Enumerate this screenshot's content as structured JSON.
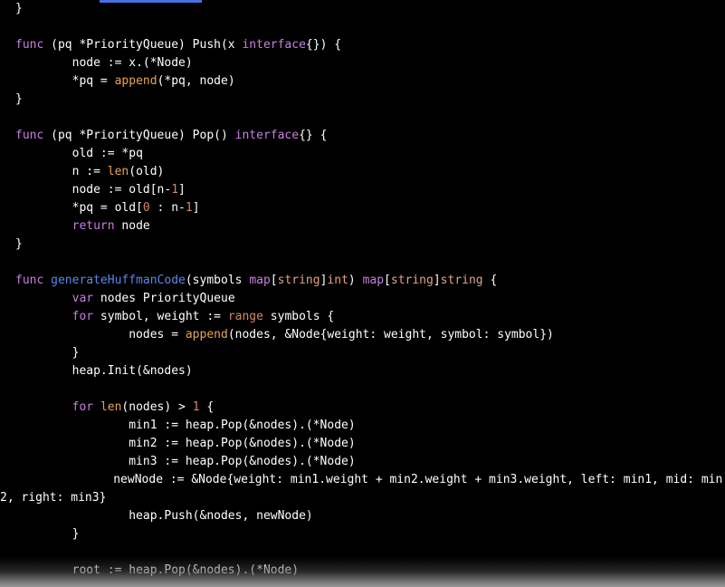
{
  "theme": {
    "background": "#000000",
    "foreground": "#ffffff",
    "keyword": "#c77fe0",
    "function_name": "#5b87e8",
    "builtin": "#e8a451",
    "type": "#e0a384",
    "number": "#d4866b",
    "selection_bar": "#4a6fe0"
  },
  "editor": {
    "language": "Go",
    "font_size_px": 13,
    "line_height_px": 20
  },
  "selection_bar": {
    "label": "text-selection-highlight"
  },
  "code": {
    "lines": [
      {
        "id": "l1",
        "indent": 0,
        "tokens": [
          {
            "t": "}",
            "c": "plain"
          }
        ]
      },
      {
        "id": "l2",
        "indent": 0,
        "tokens": []
      },
      {
        "id": "l3",
        "indent": 0,
        "tokens": [
          {
            "t": "func",
            "c": "kw"
          },
          {
            "t": " (pq *PriorityQueue) Push(x ",
            "c": "plain"
          },
          {
            "t": "interface",
            "c": "kw"
          },
          {
            "t": "{}) {",
            "c": "plain"
          }
        ]
      },
      {
        "id": "l4",
        "indent": 1,
        "tokens": [
          {
            "t": "node := x.(*Node)",
            "c": "plain"
          }
        ]
      },
      {
        "id": "l5",
        "indent": 1,
        "tokens": [
          {
            "t": "*pq = ",
            "c": "plain"
          },
          {
            "t": "append",
            "c": "bi"
          },
          {
            "t": "(*pq, node)",
            "c": "plain"
          }
        ]
      },
      {
        "id": "l6",
        "indent": 0,
        "tokens": [
          {
            "t": "}",
            "c": "plain"
          }
        ]
      },
      {
        "id": "l7",
        "indent": 0,
        "tokens": []
      },
      {
        "id": "l8",
        "indent": 0,
        "tokens": [
          {
            "t": "func",
            "c": "kw"
          },
          {
            "t": " (pq *PriorityQueue) Pop() ",
            "c": "plain"
          },
          {
            "t": "interface",
            "c": "kw"
          },
          {
            "t": "{} {",
            "c": "plain"
          }
        ]
      },
      {
        "id": "l9",
        "indent": 1,
        "tokens": [
          {
            "t": "old := *pq",
            "c": "plain"
          }
        ]
      },
      {
        "id": "l10",
        "indent": 1,
        "tokens": [
          {
            "t": "n := ",
            "c": "plain"
          },
          {
            "t": "len",
            "c": "bi"
          },
          {
            "t": "(old)",
            "c": "plain"
          }
        ]
      },
      {
        "id": "l11",
        "indent": 1,
        "tokens": [
          {
            "t": "node := old[n-",
            "c": "plain"
          },
          {
            "t": "1",
            "c": "num"
          },
          {
            "t": "]",
            "c": "plain"
          }
        ]
      },
      {
        "id": "l12",
        "indent": 1,
        "tokens": [
          {
            "t": "*pq = old[",
            "c": "plain"
          },
          {
            "t": "0",
            "c": "num"
          },
          {
            "t": " : n-",
            "c": "plain"
          },
          {
            "t": "1",
            "c": "num"
          },
          {
            "t": "]",
            "c": "plain"
          }
        ]
      },
      {
        "id": "l13",
        "indent": 1,
        "tokens": [
          {
            "t": "return",
            "c": "kw"
          },
          {
            "t": " node",
            "c": "plain"
          }
        ]
      },
      {
        "id": "l14",
        "indent": 0,
        "tokens": [
          {
            "t": "}",
            "c": "plain"
          }
        ]
      },
      {
        "id": "l15",
        "indent": 0,
        "tokens": []
      },
      {
        "id": "l16",
        "indent": 0,
        "tokens": [
          {
            "t": "func",
            "c": "kw"
          },
          {
            "t": " ",
            "c": "plain"
          },
          {
            "t": "generateHuffmanCode",
            "c": "fn"
          },
          {
            "t": "(symbols ",
            "c": "plain"
          },
          {
            "t": "map",
            "c": "kw"
          },
          {
            "t": "[",
            "c": "plain"
          },
          {
            "t": "string",
            "c": "type"
          },
          {
            "t": "]",
            "c": "plain"
          },
          {
            "t": "int",
            "c": "type"
          },
          {
            "t": ") ",
            "c": "plain"
          },
          {
            "t": "map",
            "c": "kw"
          },
          {
            "t": "[",
            "c": "plain"
          },
          {
            "t": "string",
            "c": "type"
          },
          {
            "t": "]",
            "c": "plain"
          },
          {
            "t": "string",
            "c": "type"
          },
          {
            "t": " {",
            "c": "plain"
          }
        ]
      },
      {
        "id": "l17",
        "indent": 1,
        "tokens": [
          {
            "t": "var",
            "c": "kw"
          },
          {
            "t": " nodes PriorityQueue",
            "c": "plain"
          }
        ]
      },
      {
        "id": "l18",
        "indent": 1,
        "tokens": [
          {
            "t": "for",
            "c": "kw"
          },
          {
            "t": " symbol, weight := ",
            "c": "plain"
          },
          {
            "t": "range",
            "c": "rng"
          },
          {
            "t": " symbols {",
            "c": "plain"
          }
        ]
      },
      {
        "id": "l19",
        "indent": 2,
        "tokens": [
          {
            "t": "nodes = ",
            "c": "plain"
          },
          {
            "t": "append",
            "c": "bi"
          },
          {
            "t": "(nodes, &Node{weight: weight, symbol: symbol})",
            "c": "plain"
          }
        ]
      },
      {
        "id": "l20",
        "indent": 1,
        "tokens": [
          {
            "t": "}",
            "c": "plain"
          }
        ]
      },
      {
        "id": "l21",
        "indent": 1,
        "tokens": [
          {
            "t": "heap.Init(&nodes)",
            "c": "plain"
          }
        ]
      },
      {
        "id": "l22",
        "indent": 0,
        "tokens": []
      },
      {
        "id": "l23",
        "indent": 1,
        "tokens": [
          {
            "t": "for",
            "c": "kw"
          },
          {
            "t": " ",
            "c": "plain"
          },
          {
            "t": "len",
            "c": "bi"
          },
          {
            "t": "(nodes) > ",
            "c": "plain"
          },
          {
            "t": "1",
            "c": "num"
          },
          {
            "t": " {",
            "c": "plain"
          }
        ]
      },
      {
        "id": "l24",
        "indent": 2,
        "tokens": [
          {
            "t": "min1 := heap.Pop(&nodes).(*Node)",
            "c": "plain"
          }
        ]
      },
      {
        "id": "l25",
        "indent": 2,
        "tokens": [
          {
            "t": "min2 := heap.Pop(&nodes).(*Node)",
            "c": "plain"
          }
        ]
      },
      {
        "id": "l26",
        "indent": 2,
        "tokens": [
          {
            "t": "min3 := heap.Pop(&nodes).(*Node)",
            "c": "plain"
          }
        ]
      },
      {
        "id": "l27",
        "indent": 2,
        "wrap": true,
        "tokens": [
          {
            "t": "newNode := &Node{weight: min1.weight + min2.weight + min3.weight, left: min1, mid: min2, right: min3}",
            "c": "plain"
          }
        ]
      },
      {
        "id": "l28",
        "indent": 2,
        "tokens": [
          {
            "t": "heap.Push(&nodes, newNode)",
            "c": "plain"
          }
        ]
      },
      {
        "id": "l29",
        "indent": 1,
        "tokens": [
          {
            "t": "}",
            "c": "plain"
          }
        ]
      },
      {
        "id": "l30",
        "indent": 0,
        "tokens": []
      },
      {
        "id": "l31",
        "indent": 1,
        "tokens": [
          {
            "t": "root := heap.Pop(&nodes).(*Node)",
            "c": "plain"
          }
        ]
      }
    ]
  }
}
